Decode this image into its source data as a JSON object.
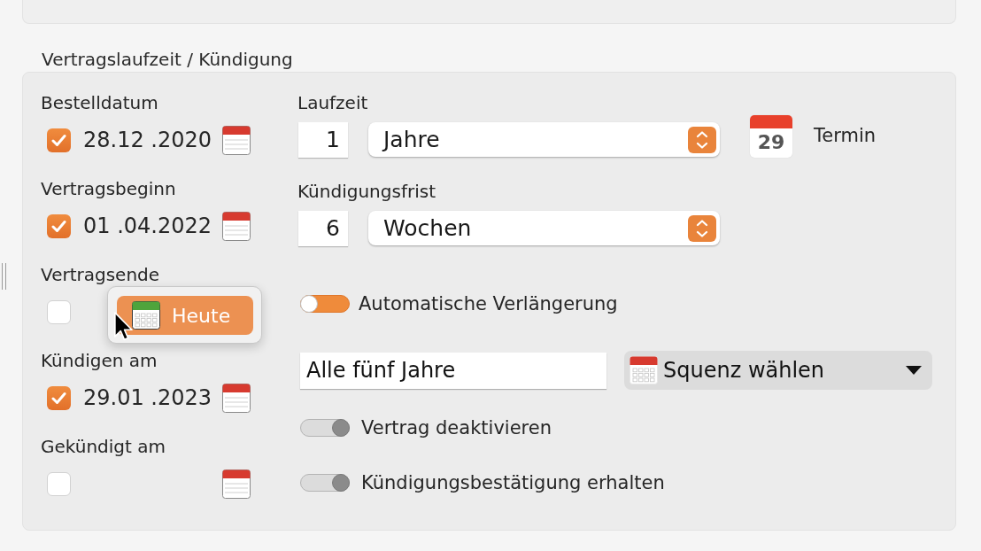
{
  "section": {
    "title": "Vertragslaufzeit / Kündigung"
  },
  "date_fields": [
    {
      "label": "Bestelldatum",
      "checked": true,
      "value": "28.12 .2020"
    },
    {
      "label": "Vertragsbeginn",
      "checked": true,
      "value": "01 .04.2022"
    },
    {
      "label": "Vertragsende",
      "checked": false,
      "popover": {
        "button": "Heute"
      }
    },
    {
      "label": "Kündigen am",
      "checked": true,
      "value": "29.01 .2023"
    },
    {
      "label": "Gekündigt am",
      "checked": false
    }
  ],
  "durations": [
    {
      "label": "Laufzeit",
      "number": "1",
      "unit": "Jahre",
      "termin": {
        "day": "29",
        "label": "Termin"
      }
    },
    {
      "label": "Kündigungsfrist",
      "number": "6",
      "unit": "Wochen"
    }
  ],
  "options": [
    {
      "kind": "toggle",
      "label": "Automatische Verlängerung",
      "on": false
    },
    {
      "kind": "sequence",
      "value": "Alle fünf Jahre",
      "popup": "Squenz wählen"
    },
    {
      "kind": "toggle",
      "label": "Vertrag deaktivieren",
      "on": true
    },
    {
      "kind": "toggle",
      "label": "Kündigungsbestätigung erhalten",
      "on": true
    }
  ]
}
